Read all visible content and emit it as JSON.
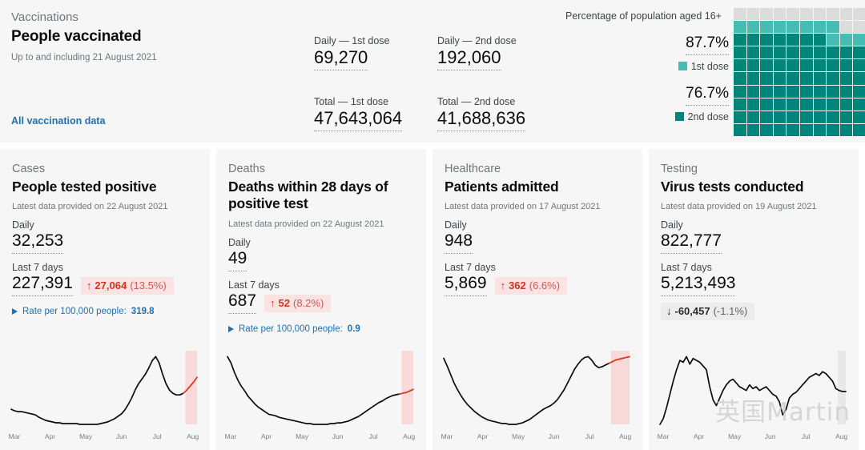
{
  "vaccinations": {
    "category": "Vaccinations",
    "title": "People vaccinated",
    "date": "Up to and including 21 August 2021",
    "link": "All vaccination data",
    "metrics": [
      {
        "label": "Daily — 1st dose",
        "value": "69,270"
      },
      {
        "label": "Daily — 2nd dose",
        "value": "192,060"
      },
      {
        "label": "Total — 1st dose",
        "value": "47,643,064"
      },
      {
        "label": "Total — 2nd dose",
        "value": "41,688,636"
      }
    ],
    "waffle": {
      "caption": "Percentage of population aged 16+",
      "first_dose_pct": "87.7%",
      "first_dose_label": "1st dose",
      "second_dose_pct": "76.7%",
      "second_dose_label": "2nd dose",
      "colors": {
        "first_dose": "#46bdb4",
        "second_dose": "#00857a",
        "empty": "#dcdcdc"
      },
      "first_dose_cells": 88,
      "second_dose_cells": 77,
      "total_cells": 100
    }
  },
  "cards": [
    {
      "category": "Cases",
      "title": "People tested positive",
      "date": "Latest data provided on 22 August 2021",
      "daily_label": "Daily",
      "daily_value": "32,253",
      "week_label": "Last 7 days",
      "week_value": "227,391",
      "change_arrow": "↑",
      "change_value": "27,064",
      "change_pct": "(13.5%)",
      "change_direction": "up",
      "rate_label": "Rate per 100,000 people:",
      "rate_value": "319.8",
      "has_rate": true,
      "badge_inline": true
    },
    {
      "category": "Deaths",
      "title": "Deaths within 28 days of positive test",
      "date": "Latest data provided on 22 August 2021",
      "daily_label": "Daily",
      "daily_value": "49",
      "week_label": "Last 7 days",
      "week_value": "687",
      "change_arrow": "↑",
      "change_value": "52",
      "change_pct": "(8.2%)",
      "change_direction": "up",
      "rate_label": "Rate per 100,000 people:",
      "rate_value": "0.9",
      "has_rate": true,
      "badge_inline": true
    },
    {
      "category": "Healthcare",
      "title": "Patients admitted",
      "date": "Latest data provided on 17 August 2021",
      "daily_label": "Daily",
      "daily_value": "948",
      "week_label": "Last 7 days",
      "week_value": "5,869",
      "change_arrow": "↑",
      "change_value": "362",
      "change_pct": "(6.6%)",
      "change_direction": "up",
      "rate_label": "",
      "rate_value": "",
      "has_rate": false,
      "badge_inline": true
    },
    {
      "category": "Testing",
      "title": "Virus tests conducted",
      "date": "Latest data provided on 19 August 2021",
      "daily_label": "Daily",
      "daily_value": "822,777",
      "week_label": "Last 7 days",
      "week_value": "5,213,493",
      "change_arrow": "↓",
      "change_value": "-60,457",
      "change_pct": "(-1.1%)",
      "change_direction": "down",
      "rate_label": "",
      "rate_value": "",
      "has_rate": false,
      "badge_inline": false
    }
  ],
  "watermark": "英国Martin",
  "chart_data": [
    {
      "type": "line",
      "title": "People tested positive — daily (7-day rolling)",
      "xlabel": "",
      "ylabel": "",
      "tick_labels": [
        "Mar",
        "Apr",
        "May",
        "Jun",
        "Jul",
        "Aug"
      ],
      "line_color": "#0b0c0c",
      "highlight_color": "#d4351c",
      "band_color": "#f9d9d9",
      "values": [
        34,
        32,
        31,
        31,
        30,
        29,
        28,
        27,
        24,
        22,
        20,
        19,
        18,
        17,
        17,
        16,
        16,
        16,
        16,
        16,
        15,
        15,
        15,
        15,
        15,
        15,
        16,
        17,
        18,
        20,
        22,
        25,
        28,
        33,
        40,
        48,
        58,
        66,
        72,
        78,
        86,
        95,
        100,
        92,
        78,
        66,
        58,
        54,
        52,
        52,
        54,
        58,
        63,
        68,
        74
      ],
      "incomplete_from": 50
    },
    {
      "type": "line",
      "title": "Deaths within 28 days of positive test — daily (7-day rolling)",
      "xlabel": "",
      "ylabel": "",
      "tick_labels": [
        "Mar",
        "Apr",
        "May",
        "Jun",
        "Jul",
        "Aug"
      ],
      "line_color": "#0b0c0c",
      "highlight_color": "#d4351c",
      "band_color": "#f9d9d9",
      "values": [
        96,
        88,
        76,
        66,
        58,
        52,
        45,
        40,
        35,
        31,
        28,
        25,
        22,
        21,
        20,
        18,
        17,
        16,
        15,
        14,
        13,
        12,
        11,
        10,
        10,
        9,
        9,
        9,
        9,
        9,
        10,
        10,
        11,
        11,
        12,
        13,
        15,
        17,
        19,
        22,
        25,
        28,
        31,
        34,
        37,
        39,
        42,
        44,
        46,
        47,
        48,
        49,
        50,
        52,
        54
      ],
      "incomplete_from": 50
    },
    {
      "type": "line",
      "title": "Patients admitted — daily (7-day rolling)",
      "xlabel": "",
      "ylabel": "",
      "tick_labels": [
        "Mar",
        "Apr",
        "May",
        "Jun",
        "Jul",
        "Aug"
      ],
      "line_color": "#0b0c0c",
      "highlight_color": "#d4351c",
      "band_color": "#f9d9d9",
      "values": [
        95,
        86,
        76,
        66,
        58,
        51,
        45,
        40,
        36,
        32,
        29,
        26,
        24,
        22,
        21,
        20,
        19,
        18,
        18,
        17,
        17,
        17,
        18,
        19,
        21,
        23,
        26,
        29,
        32,
        35,
        37,
        39,
        42,
        46,
        52,
        58,
        66,
        74,
        82,
        88,
        93,
        96,
        97,
        93,
        87,
        84,
        85,
        87,
        89,
        91,
        93,
        94,
        95,
        96,
        97
      ],
      "incomplete_from": 48
    },
    {
      "type": "line",
      "title": "Virus tests conducted — daily (7-day rolling)",
      "xlabel": "",
      "ylabel": "",
      "tick_labels": [
        "Mar",
        "Apr",
        "May",
        "Jun",
        "Jul",
        "Aug"
      ],
      "line_color": "#0b0c0c",
      "highlight_color": "#0b0c0c",
      "band_color": "#e8e8e8",
      "values": [
        20,
        26,
        38,
        52,
        66,
        78,
        88,
        86,
        92,
        84,
        90,
        88,
        86,
        82,
        78,
        60,
        46,
        40,
        48,
        56,
        62,
        66,
        68,
        64,
        60,
        58,
        56,
        62,
        58,
        60,
        56,
        58,
        60,
        56,
        52,
        50,
        44,
        30,
        36,
        48,
        52,
        54,
        58,
        62,
        66,
        70,
        72,
        74,
        72,
        76,
        74,
        70,
        66,
        58,
        56,
        55,
        55
      ],
      "incomplete_from": 53
    }
  ]
}
